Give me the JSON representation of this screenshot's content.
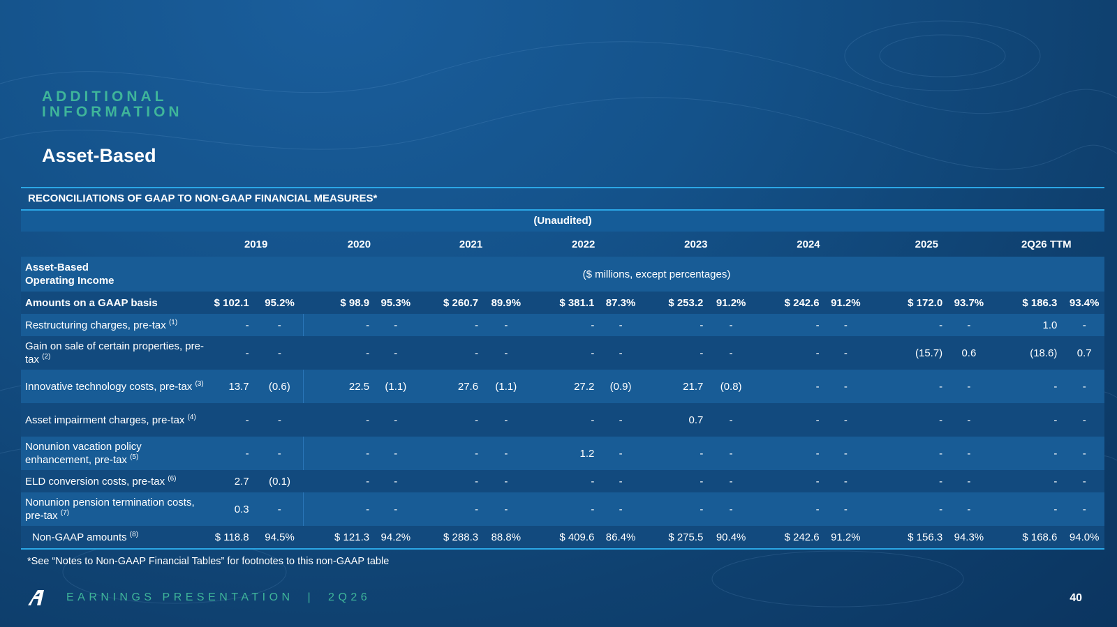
{
  "kicker": "ADDITIONAL INFORMATION",
  "title": "Asset-Based",
  "table": {
    "heading": "RECONCILIATIONS OF GAAP TO NON-GAAP FINANCIAL MEASURES*",
    "unaudited": "(Unaudited)",
    "years": [
      "2019",
      "2020",
      "2021",
      "2022",
      "2023",
      "2024",
      "2025",
      "2Q26 TTM"
    ],
    "section_label_line1": "Asset-Based",
    "section_label_line2": "Operating Income",
    "units": "($ millions, except percentages)",
    "rows": [
      {
        "label": "Amounts on a GAAP basis",
        "sup": "",
        "bold": true,
        "style": "dark",
        "cells": [
          "$ 102.1",
          "95.2%",
          "$ 98.9",
          "95.3%",
          "$ 260.7",
          "89.9%",
          "$ 381.1",
          "87.3%",
          "$ 253.2",
          "91.2%",
          "$ 242.6",
          "91.2%",
          "$ 172.0",
          "93.7%",
          "$ 186.3",
          "93.4%"
        ]
      },
      {
        "label": "Restructuring charges, pre-tax",
        "sup": "(1)",
        "style": "shade",
        "cells": [
          "-",
          "-",
          "-",
          "-",
          "-",
          "-",
          "-",
          "-",
          "-",
          "-",
          "-",
          "-",
          "-",
          "-",
          "1.0",
          "-"
        ]
      },
      {
        "label": "Gain on sale of certain properties, pre-tax",
        "sup": "(2)",
        "style": "dark",
        "cells": [
          "-",
          "-",
          "-",
          "-",
          "-",
          "-",
          "-",
          "-",
          "-",
          "-",
          "-",
          "-",
          "(15.7)",
          "0.6",
          "(18.6)",
          "0.7"
        ]
      },
      {
        "label": "Innovative technology costs, pre-tax",
        "sup": "(3)",
        "style": "shade",
        "cells": [
          "13.7",
          "(0.6)",
          "22.5",
          "(1.1)",
          "27.6",
          "(1.1)",
          "27.2",
          "(0.9)",
          "21.7",
          "(0.8)",
          "-",
          "-",
          "-",
          "-",
          "-",
          "-"
        ]
      },
      {
        "label": "Asset impairment charges, pre-tax",
        "sup": "(4)",
        "style": "dark",
        "cells": [
          "-",
          "-",
          "-",
          "-",
          "-",
          "-",
          "-",
          "-",
          "0.7",
          "-",
          "-",
          "-",
          "-",
          "-",
          "-",
          "-"
        ]
      },
      {
        "label": "Nonunion vacation policy enhancement, pre-tax",
        "sup": "(5)",
        "style": "shade",
        "cells": [
          "-",
          "-",
          "-",
          "-",
          "-",
          "-",
          "1.2",
          "-",
          "-",
          "-",
          "-",
          "-",
          "-",
          "-",
          "-",
          "-"
        ]
      },
      {
        "label": "ELD conversion costs, pre-tax",
        "sup": "(6)",
        "style": "dark",
        "cells": [
          "2.7",
          "(0.1)",
          "-",
          "-",
          "-",
          "-",
          "-",
          "-",
          "-",
          "-",
          "-",
          "-",
          "-",
          "-",
          "-",
          "-"
        ]
      },
      {
        "label": "Nonunion pension termination costs, pre-tax",
        "sup": "(7)",
        "style": "shade",
        "cells": [
          "0.3",
          "-",
          "-",
          "-",
          "-",
          "-",
          "-",
          "-",
          "-",
          "-",
          "-",
          "-",
          "-",
          "-",
          "-",
          "-"
        ]
      },
      {
        "label": "Non-GAAP amounts",
        "sup": "(8)",
        "style": "dark",
        "indent": true,
        "cells": [
          "$ 118.8",
          "94.5%",
          "$ 121.3",
          "94.2%",
          "$ 288.3",
          "88.8%",
          "$ 409.6",
          "86.4%",
          "$ 275.5",
          "90.4%",
          "$ 242.6",
          "91.2%",
          "$ 156.3",
          "94.3%",
          "$ 168.6",
          "94.0%"
        ]
      }
    ]
  },
  "note": "*See “Notes to Non-GAAP Financial Tables” for footnotes to this non-GAAP table",
  "footer": "EARNINGS PRESENTATION  |  2Q26",
  "page_number": "40",
  "colors": {
    "accent_teal": "#3fb59a",
    "rule_blue": "#2ba7e6",
    "bg": "#14528a"
  }
}
